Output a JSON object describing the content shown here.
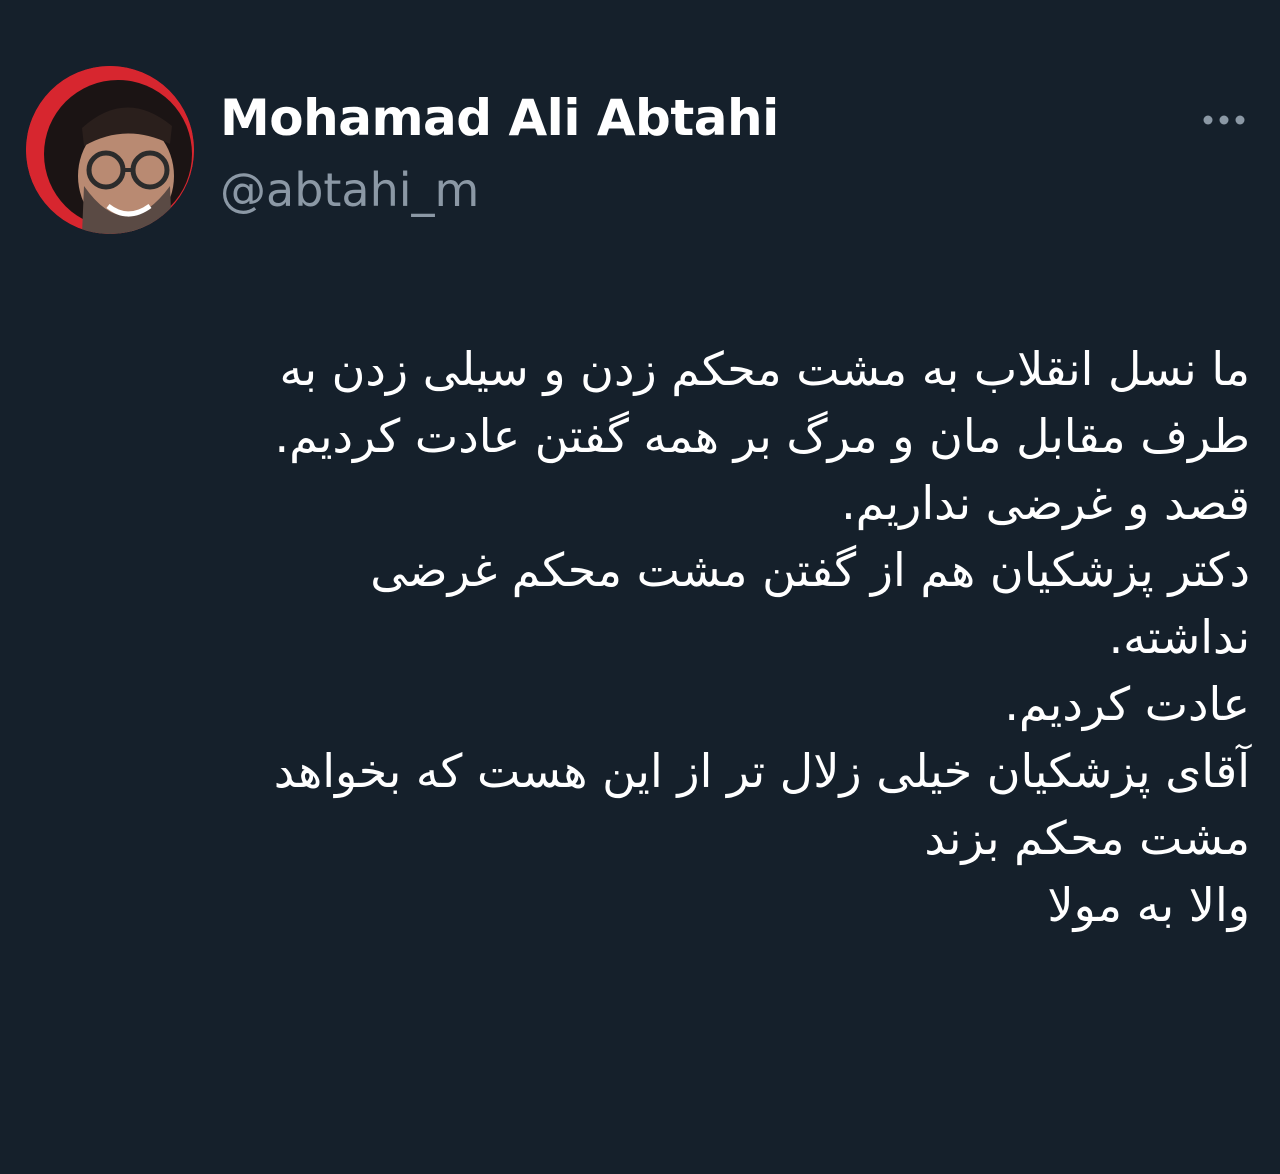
{
  "tweet": {
    "author": {
      "display_name": "Mohamad Ali Abtahi",
      "handle": "@abtahi_m"
    },
    "more_icon": "more-horizontal-icon",
    "text_lines": [
      "ما نسل انقلاب به مشت محکم زدن و سیلی زدن به",
      "طرف مقابل مان و مرگ بر همه گفتن عادت کردیم.",
      "قصد و غرضی نداریم.",
      "دکتر پزشکیان هم از گفتن مشت محکم غرضی",
      "نداشته.",
      "عادت کردیم.",
      "آقای پزشکیان خیلی زلال تر از این هست که بخواهد",
      "مشت محکم بزند",
      "والا به مولا"
    ]
  },
  "colors": {
    "background": "#15202b",
    "primary_text": "#ffffff",
    "secondary_text": "#8b98a5",
    "avatar_ring": "#d7262f"
  }
}
